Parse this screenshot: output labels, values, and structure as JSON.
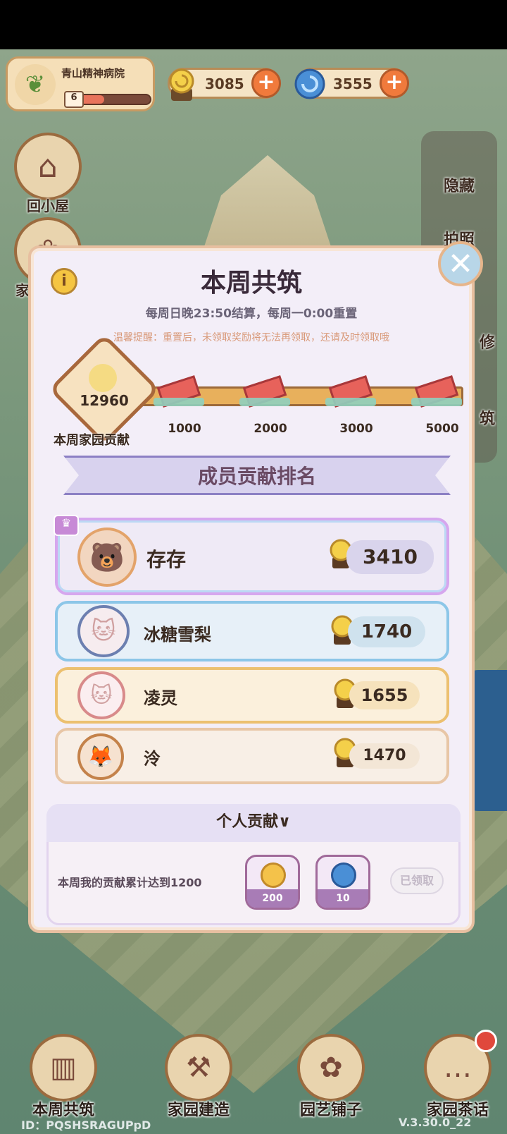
{
  "top": {
    "home_name": "青山精神病院",
    "level": "6",
    "level_progress": 0.35,
    "snail_coins": "3085",
    "swirl_gems": "3555",
    "plus_label": "+"
  },
  "side": {
    "back_home": "回小屋",
    "left_partial": "家",
    "hide": "隐藏",
    "photo": "拍照",
    "repair": "修",
    "build": "筑"
  },
  "modal": {
    "title": "本周共筑",
    "subtitle": "每周日晚23:50结算，每周一0:00重置",
    "tip": "温馨提醒：重置后，未领取奖励将无法再领取，还请及时领取哦",
    "info_label": "i",
    "close_label": "✕",
    "total_value": "12960",
    "total_label": "本周家园贡献",
    "milestones": [
      "1000",
      "2000",
      "3000",
      "5000"
    ],
    "ranking_title": "成员贡献排名",
    "ranking": [
      {
        "name": "存存",
        "score": "3410"
      },
      {
        "name": "冰糖雪梨",
        "score": "1740"
      },
      {
        "name": "凌灵",
        "score": "1655"
      },
      {
        "name": "泠",
        "score": "1470"
      }
    ],
    "personal_title": "个人贡献∨",
    "personal_desc": "本周我的贡献累计达到1200",
    "rewards": [
      "200",
      "10"
    ],
    "claimed_label": "已领取"
  },
  "nav": {
    "items": [
      "本周共筑",
      "家园建造",
      "园艺铺子",
      "家园茶话"
    ]
  },
  "footer": {
    "id": "ID：PQSHSRAGUPpD",
    "version": "V.3.30.0_22"
  },
  "colors": {
    "accent_orange": "#f07a3c",
    "modal_bg": "#f3eef8",
    "gift_red": "#e7625b"
  }
}
